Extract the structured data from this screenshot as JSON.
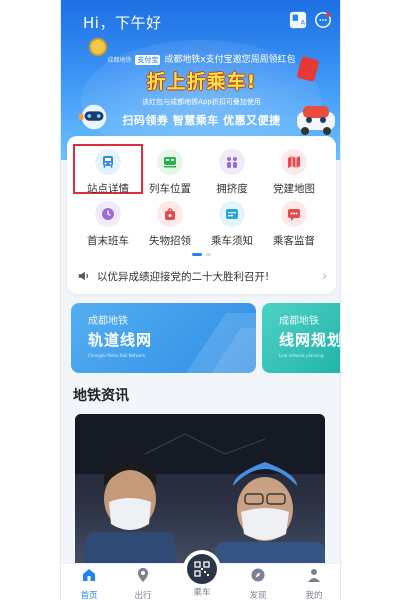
{
  "header": {
    "greeting": "Hi，下午好",
    "icons": [
      "translate-icon",
      "chat-icon"
    ]
  },
  "banner": {
    "sponsor": "成都地铁x支付宝邀您周周领红包",
    "sponsor_logo_a": "成都地铁",
    "sponsor_logo_b": "支付宝",
    "headline": "折上折乘车!",
    "subline": "该红包与成都地铁App折扣可叠加使用",
    "slogan": "扫码领券 智慧乘车 优惠又便捷"
  },
  "menu": {
    "items": [
      {
        "label": "站点详情",
        "icon": "train-icon",
        "color": "#2f8ae8"
      },
      {
        "label": "列车位置",
        "icon": "train-position-icon",
        "color": "#26b24b"
      },
      {
        "label": "拥挤度",
        "icon": "crowd-icon",
        "color": "#9b6bd6"
      },
      {
        "label": "党建地图",
        "icon": "map-icon",
        "color": "#e24b4b"
      },
      {
        "label": "首末班车",
        "icon": "clock-icon",
        "color": "#9b6bd6"
      },
      {
        "label": "失物招领",
        "icon": "bag-icon",
        "color": "#e24b4b"
      },
      {
        "label": "乘车须知",
        "icon": "notice-card-icon",
        "color": "#24a6d8"
      },
      {
        "label": "乘客监督",
        "icon": "feedback-icon",
        "color": "#e24b4b"
      }
    ],
    "page_count": 2,
    "active_page": 1
  },
  "notice": {
    "text": "以优异成绩迎接党的二十大胜利召开!"
  },
  "routes": [
    {
      "tag": "成都地铁",
      "title": "轨道线网",
      "en": "Chengdu Metro Rail Network"
    },
    {
      "tag": "成都地铁",
      "title": "线网规划",
      "en": "Line network planning"
    }
  ],
  "news": {
    "title": "地铁资讯"
  },
  "nav": {
    "items": [
      {
        "label": "首页",
        "icon": "home-icon",
        "active": true
      },
      {
        "label": "出行",
        "icon": "location-icon"
      },
      {
        "label": "乘车",
        "icon": "qr-code-icon"
      },
      {
        "label": "发现",
        "icon": "compass-icon"
      },
      {
        "label": "我的",
        "icon": "user-icon"
      }
    ]
  },
  "colors": {
    "accent": "#1f86f0",
    "highlight_box": "#e02c3f",
    "headline": "#ffe14a"
  }
}
